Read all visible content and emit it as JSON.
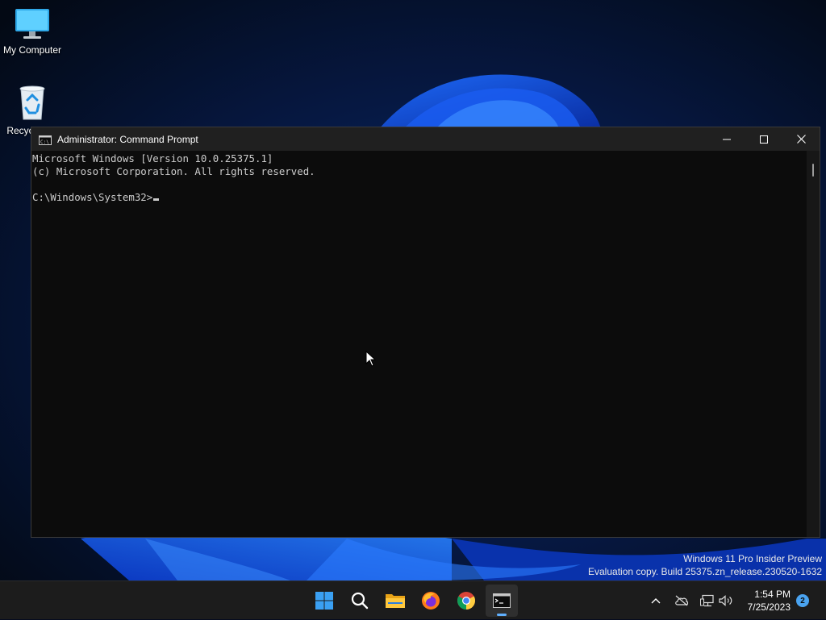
{
  "desktop": {
    "icons": [
      {
        "label": "My Computer",
        "icon": "monitor-icon"
      },
      {
        "label": "Recycle Bin",
        "icon": "recycle-bin-icon"
      }
    ]
  },
  "window": {
    "title": "Administrator: Command Prompt",
    "controls": [
      "minimize-icon",
      "maximize-icon",
      "close-icon"
    ],
    "console_lines": [
      "Microsoft Windows [Version 10.0.25375.1]",
      "(c) Microsoft Corporation. All rights reserved.",
      "",
      "C:\\Windows\\System32>"
    ]
  },
  "watermark": {
    "line1": "Windows 11 Pro Insider Preview",
    "line2": "Evaluation copy. Build 25375.zn_release.230520-1632"
  },
  "taskbar": {
    "apps": [
      {
        "name": "start",
        "icon": "windows-start-icon"
      },
      {
        "name": "search",
        "icon": "search-icon"
      },
      {
        "name": "file-explorer",
        "icon": "folder-icon"
      },
      {
        "name": "firefox",
        "icon": "firefox-icon"
      },
      {
        "name": "chrome",
        "icon": "chrome-icon"
      },
      {
        "name": "terminal",
        "icon": "terminal-icon",
        "active": true
      }
    ],
    "tray": {
      "time": "1:54 PM",
      "date": "7/25/2023",
      "notification_count": "2"
    }
  },
  "colors": {
    "console_bg": "#0c0c0c",
    "console_text": "#cccccc",
    "titlebar": "#202020",
    "taskbar": "#1c1c1c",
    "accent": "#4aa3f0"
  }
}
